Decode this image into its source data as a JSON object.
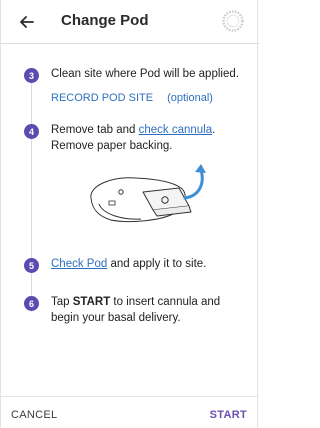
{
  "header": {
    "back_icon": "arrow-left-icon",
    "title": "Change Pod",
    "status_icon": "pod-status-ring-icon"
  },
  "steps": [
    {
      "number": "3",
      "text": "Clean site where Pod will be applied.",
      "record_label": "RECORD POD SITE",
      "optional_label": "(optional)"
    },
    {
      "number": "4",
      "text_before": "Remove tab and ",
      "link": "check cannula",
      "text_after": ". Remove paper backing."
    },
    {
      "number": "5",
      "link": "Check Pod",
      "text_after": " and apply it to site."
    },
    {
      "number": "6",
      "text_before": "Tap ",
      "bold": "START",
      "text_after": " to insert cannula and begin your basal delivery."
    }
  ],
  "illustration": {
    "name": "pod-removal-illustration",
    "accent": "#3f8fd6"
  },
  "footer": {
    "cancel_label": "CANCEL",
    "start_label": "START"
  },
  "colors": {
    "step_circle": "#5b4bb0",
    "link": "#2f6fc1",
    "start": "#6a4fb5"
  }
}
